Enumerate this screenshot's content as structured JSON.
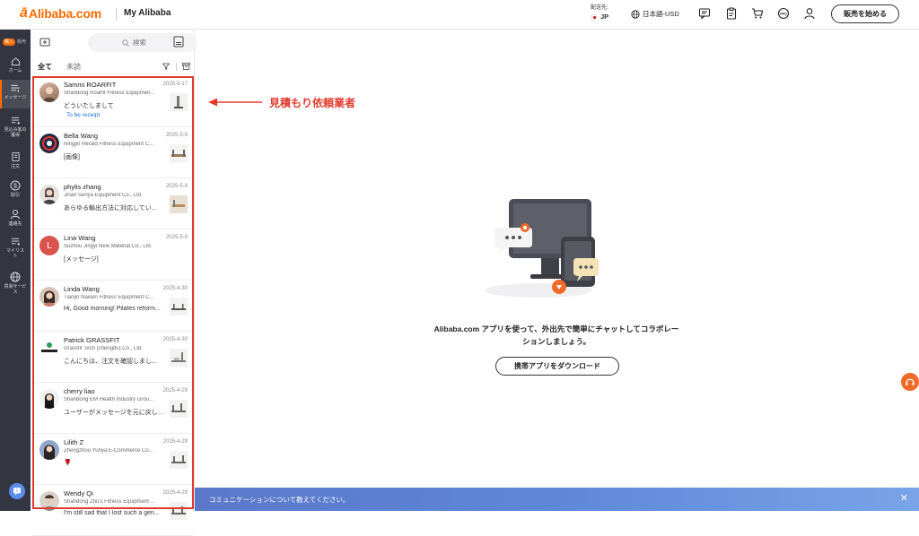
{
  "header": {
    "logo_text": "Alibaba.com",
    "my_alibaba": "My Alibaba",
    "ship_to_label": "配送先:",
    "ship_to_country": "JP",
    "language": "日本語-USD",
    "sell_button": "販売を始める"
  },
  "leftnav": {
    "toggle_on": "購入",
    "toggle_off": "販売",
    "items": [
      {
        "label": "ホーム",
        "icon": "home-icon"
      },
      {
        "label": "メッセージ",
        "icon": "messages-icon"
      },
      {
        "label": "見込み客の獲得",
        "icon": "leads-icon"
      },
      {
        "label": "注文",
        "icon": "orders-icon"
      },
      {
        "label": "取引",
        "icon": "transactions-icon"
      },
      {
        "label": "連絡先",
        "icon": "contacts-icon"
      },
      {
        "label": "マイリスト",
        "icon": "mylist-icon"
      },
      {
        "label": "貿易サービス",
        "icon": "trade-services-icon"
      }
    ]
  },
  "inbox": {
    "search_placeholder": "検索",
    "tabs": [
      "全て",
      "未読"
    ],
    "conversations": [
      {
        "name": "Sammi ROARFIT",
        "date": "2025-5-17",
        "company": "Shandong Roarfit Fitness Equipmen...",
        "snippet": "どういたしまして",
        "tag": "To be receipt"
      },
      {
        "name": "Bella Wang",
        "date": "2025-5-9",
        "company": "Ningjin Herald Fitness Equipment C...",
        "snippet": "[画像]",
        "tag": ""
      },
      {
        "name": "phylis zhang",
        "date": "2025-5-9",
        "company": "Jinan Senya Equipment Co., Ltd.",
        "snippet": "あらゆる輸出方法に対応してい...",
        "tag": ""
      },
      {
        "name": "Lina Wang",
        "date": "2025-5-8",
        "company": "Suzhou Jingyi New Material Co., Ltd.",
        "snippet": "[メッセージ]",
        "tag": ""
      },
      {
        "name": "Linda Wang",
        "date": "2025-4-30",
        "company": "Tianjin Naisen Fitness Equipment C...",
        "snippet": "Hi, Good morning! Pilates reform...",
        "tag": ""
      },
      {
        "name": "Patrick GRASSFIT",
        "date": "2025-4-30",
        "company": "Grassfit Tech (chengdu) Co., Ltd.",
        "snippet": "こんにちは、注文を確認しまし...",
        "tag": ""
      },
      {
        "name": "cherry liao",
        "date": "2025-4-29",
        "company": "Shandong EM Health Industry Grou...",
        "snippet": "ユーザーがメッセージを元に戻しまし...",
        "tag": ""
      },
      {
        "name": "Lilith Z",
        "date": "2025-4-29",
        "company": "Zhengzhou Yunya E-Commerce Co...",
        "snippet": "🌹",
        "tag": ""
      },
      {
        "name": "Wendy Qi",
        "date": "2025-4-29",
        "company": "Shandong Zhu's Fitness Equipment ...",
        "snippet": "I'm still sad that I lost such a gen...",
        "tag": ""
      }
    ]
  },
  "annotation": {
    "text": "見積もり依頼業者",
    "color": "#e23b2e"
  },
  "main": {
    "empty_text": "Alibaba.com アプリを使って、外出先で簡単にチャットしてコラボレーションしましょう。",
    "download_button": "携帯アプリをダウンロード"
  },
  "banner": {
    "text": "コミュニケーションについて教えてください。",
    "close": "✕"
  },
  "colors": {
    "brand": "#ff6a00",
    "nav_bg": "#333640",
    "link_blue": "#1b6bd6"
  }
}
